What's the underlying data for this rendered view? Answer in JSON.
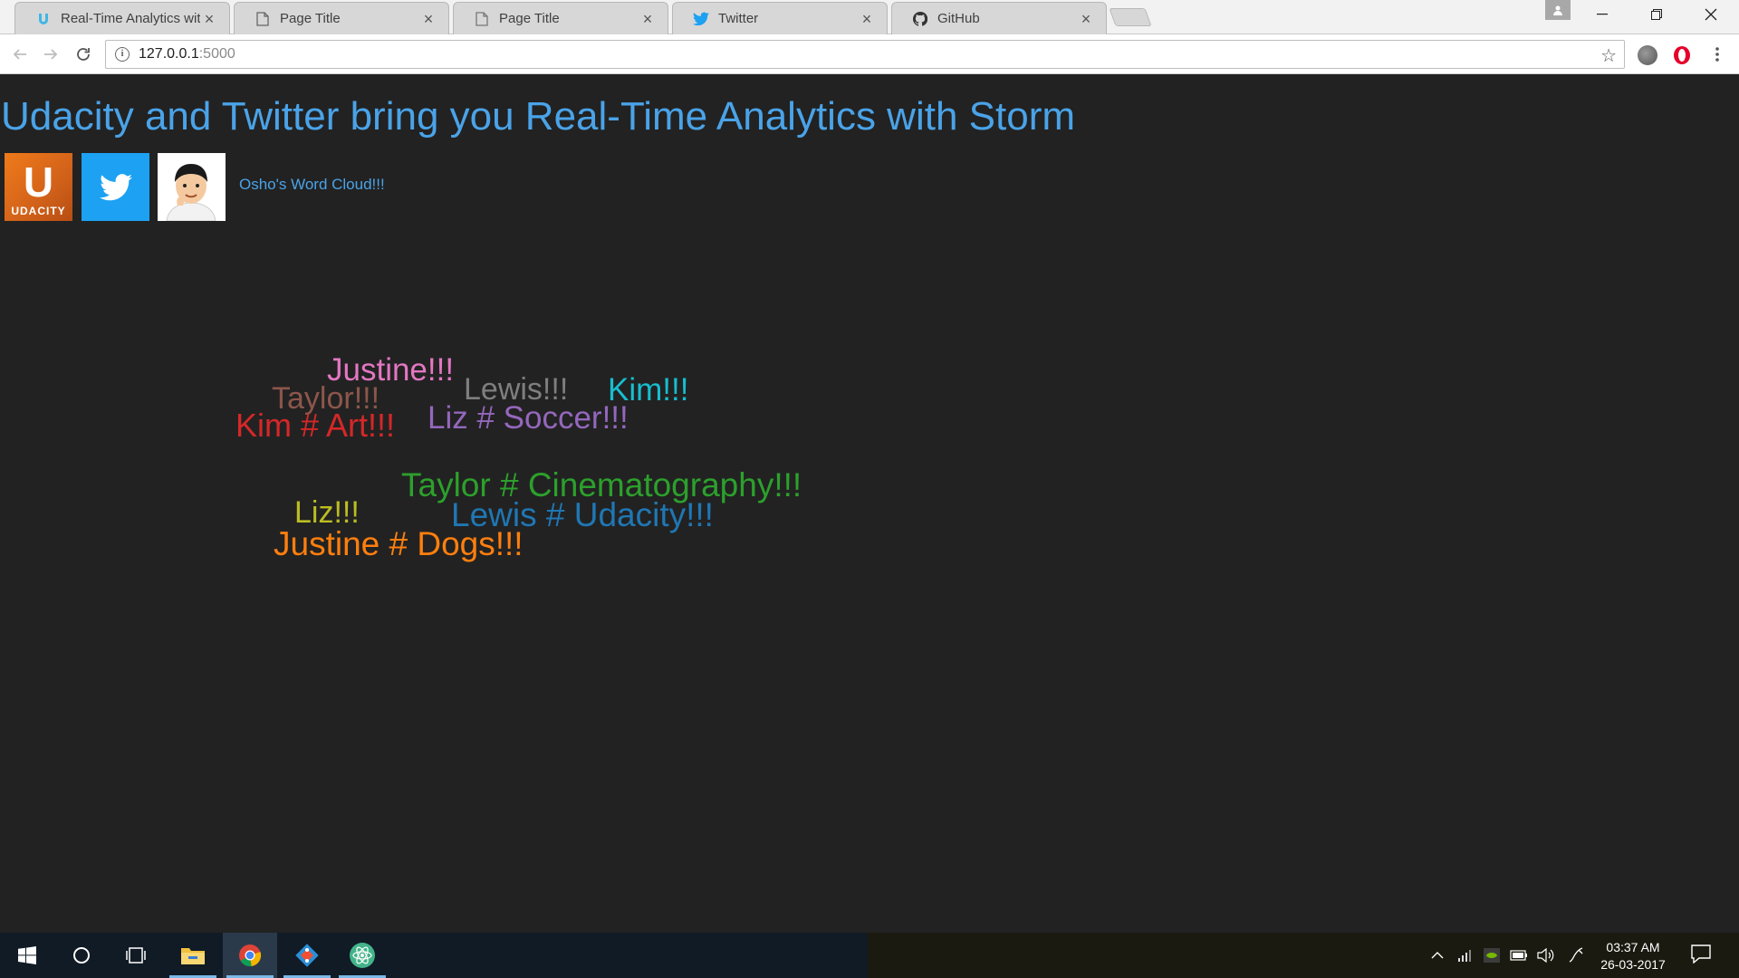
{
  "browser": {
    "tabs": [
      {
        "title": "Real-Time Analytics with",
        "icon": "udacity-favicon-icon",
        "active": false
      },
      {
        "title": "Page Title",
        "icon": "page-icon",
        "active": true
      },
      {
        "title": "Page Title",
        "icon": "page-icon",
        "active": false
      },
      {
        "title": "Twitter",
        "icon": "twitter-bird-icon",
        "active": false
      },
      {
        "title": "GitHub",
        "icon": "github-icon",
        "active": false
      }
    ],
    "tab_close_glyph": "×",
    "url_host": "127.0.0.1",
    "url_port": ":5000"
  },
  "page": {
    "title": "Udacity and Twitter bring you Real-Time Analytics with Storm",
    "udacity_logo_text": "UDACITY",
    "udacity_logo_glyph": "U",
    "cloud_link": "Osho's Word Cloud!!!",
    "accent_color": "#4aa3e8",
    "background_color": "#222222"
  },
  "word_cloud": [
    {
      "text": "Justine!!!",
      "color": "#e377c2"
    },
    {
      "text": "Taylor!!!",
      "color": "#8c564b"
    },
    {
      "text": "Lewis!!!",
      "color": "#7f7f7f"
    },
    {
      "text": "Kim!!!",
      "color": "#17becf"
    },
    {
      "text": "Kim # Art!!!",
      "color": "#d62728"
    },
    {
      "text": "Liz # Soccer!!!",
      "color": "#9467bd"
    },
    {
      "text": "Taylor # Cinematography!!!",
      "color": "#2ca02c"
    },
    {
      "text": "Liz!!!",
      "color": "#bcbd22"
    },
    {
      "text": "Lewis # Udacity!!!",
      "color": "#1f77b4"
    },
    {
      "text": "Justine # Dogs!!!",
      "color": "#ff7f0e"
    }
  ],
  "taskbar": {
    "time": "03:37 AM",
    "date": "26-03-2017"
  }
}
